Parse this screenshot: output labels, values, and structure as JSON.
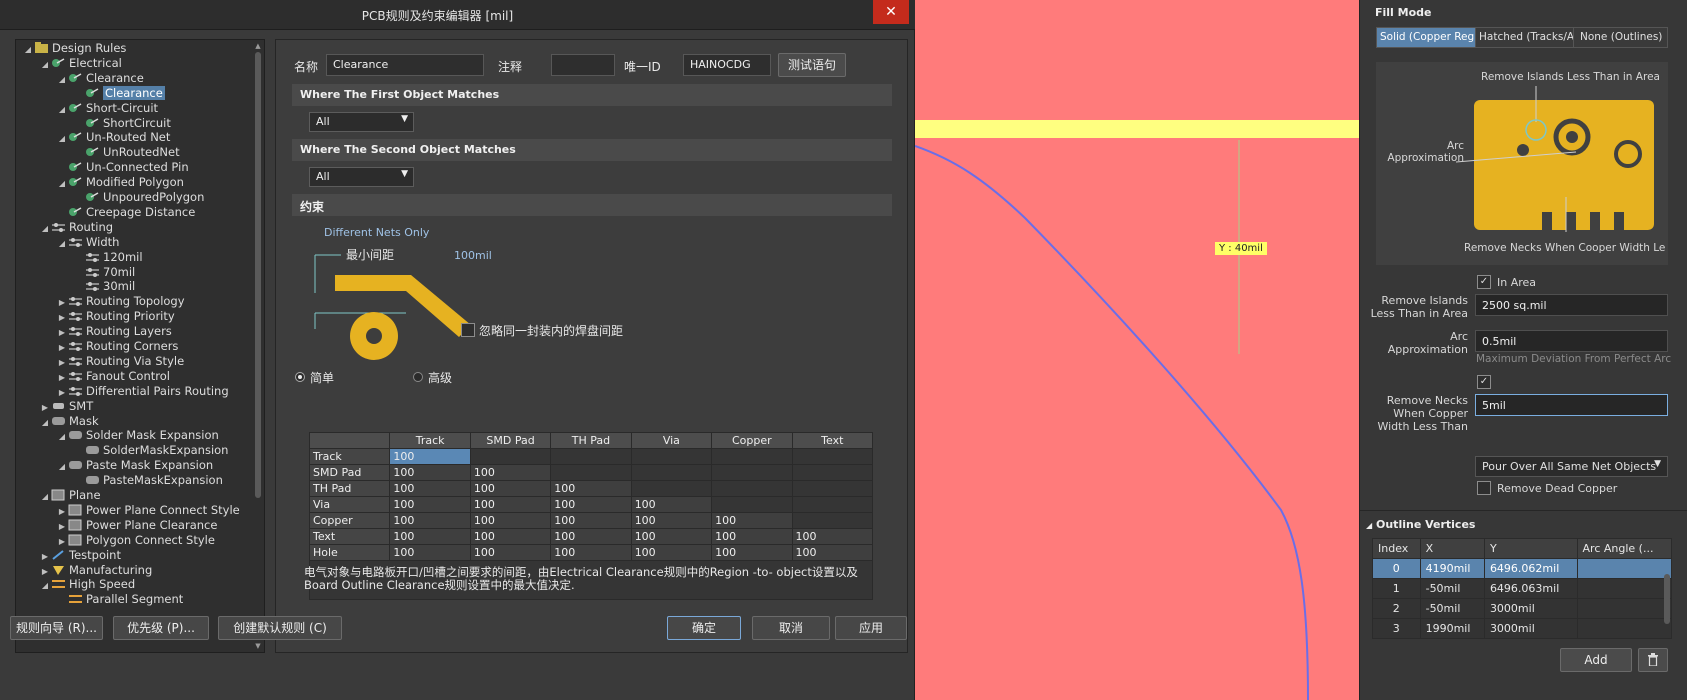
{
  "dialog": {
    "title": "PCB规则及约束编辑器 [mil]",
    "close_glyph": "✕"
  },
  "tree": {
    "root": "Design Rules",
    "electrical": "Electrical",
    "clearance_cat": "Clearance",
    "clearance_rule": "Clearance",
    "short_circuit_cat": "Short-Circuit",
    "short_circuit_rule": "ShortCircuit",
    "unrouted_cat": "Un-Routed Net",
    "unrouted_rule": "UnRoutedNet",
    "unconnected_pin": "Un-Connected Pin",
    "modified_polygon": "Modified Polygon",
    "unpoured_polygon": "UnpouredPolygon",
    "creepage": "Creepage Distance",
    "routing": "Routing",
    "width": "Width",
    "w120": "120mil",
    "w70": "70mil",
    "w30": "30mil",
    "routing_topology": "Routing Topology",
    "routing_priority": "Routing Priority",
    "routing_layers": "Routing Layers",
    "routing_corners": "Routing Corners",
    "routing_via_style": "Routing Via Style",
    "fanout_control": "Fanout Control",
    "diff_pairs": "Differential Pairs Routing",
    "smt": "SMT",
    "mask": "Mask",
    "solder_mask_cat": "Solder Mask Expansion",
    "solder_mask_rule": "SolderMaskExpansion",
    "paste_mask_cat": "Paste Mask Expansion",
    "paste_mask_rule": "PasteMaskExpansion",
    "plane": "Plane",
    "power_plane_connect": "Power Plane Connect Style",
    "power_plane_clearance": "Power Plane Clearance",
    "polygon_connect": "Polygon Connect Style",
    "testpoint": "Testpoint",
    "manufacturing": "Manufacturing",
    "high_speed": "High Speed",
    "parallel_segment": "Parallel Segment"
  },
  "form": {
    "name_label": "名称",
    "name_value": "Clearance",
    "comment_label": "注释",
    "comment_value": "",
    "uid_label": "唯一ID",
    "uid_value": "HAINOCDG",
    "test_button": "测试语句",
    "first_match": "Where The First Object Matches",
    "first_match_value": "All",
    "second_match": "Where The Second Object Matches",
    "second_match_value": "All",
    "constraints": "约束",
    "different_nets": "Different Nets Only",
    "min_clearance_label": "最小间距",
    "min_clearance_value": "100mil",
    "ignore_pads": "忽略同一封装内的焊盘间距",
    "mode_simple": "简单",
    "mode_advanced": "高级",
    "columns": [
      "",
      "Track",
      "SMD Pad",
      "TH Pad",
      "Via",
      "Copper",
      "Text"
    ],
    "rows": [
      {
        "label": "Track",
        "cells": [
          "100"
        ]
      },
      {
        "label": "SMD Pad",
        "cells": [
          "100",
          "100"
        ]
      },
      {
        "label": "TH Pad",
        "cells": [
          "100",
          "100",
          "100"
        ]
      },
      {
        "label": "Via",
        "cells": [
          "100",
          "100",
          "100",
          "100"
        ]
      },
      {
        "label": "Copper",
        "cells": [
          "100",
          "100",
          "100",
          "100",
          "100"
        ]
      },
      {
        "label": "Text",
        "cells": [
          "100",
          "100",
          "100",
          "100",
          "100",
          "100"
        ]
      },
      {
        "label": "Hole",
        "cells": [
          "100",
          "100",
          "100",
          "100",
          "100",
          "100"
        ]
      }
    ],
    "description": "电气对象与电路板开口/凹槽之间要求的间距，由Electrical Clearance规则中的Region -to- object设置以及Board Outline Clearance规则设置中的最大值决定."
  },
  "footer": {
    "wizard": "规则向导 (R)...",
    "priority": "优先级 (P)...",
    "create_default": "创建默认规则 (C)",
    "ok": "确定",
    "cancel": "取消",
    "apply": "应用"
  },
  "canvas": {
    "y_readout": "Y : 40mil",
    "background": "#ff7b7b",
    "track_color": "#ffff80"
  },
  "panel": {
    "fill_mode": "Fill Mode",
    "mode_solid": "Solid (Copper Regi",
    "mode_hatched": "Hatched (Tracks/Ar",
    "mode_none": "None (Outlines)",
    "diagram_islands": "Remove Islands Less Than in Area",
    "diagram_arc": "Arc Approximation",
    "diagram_necks": "Remove Necks When Cooper Width Le",
    "in_area": "In Area",
    "islands_label": "Remove Islands Less Than in Area",
    "islands_value": "2500 sq.mil",
    "arc_label": "Arc Approximation",
    "arc_value": "0.5mil",
    "arc_hint": "Maximum Deviation From Perfect Arc",
    "necks_label": "Remove Necks When Copper Width Less Than",
    "necks_value": "5mil",
    "pour_over": "Pour Over All Same Net Objects",
    "remove_dead": "Remove Dead Copper",
    "outline_vertices": "Outline Vertices",
    "ov_columns": [
      "Index",
      "X",
      "Y",
      "Arc Angle (..."
    ],
    "ov_rows": [
      [
        "0",
        "4190mil",
        "6496.062mil",
        ""
      ],
      [
        "1",
        "-50mil",
        "6496.063mil",
        ""
      ],
      [
        "2",
        "-50mil",
        "3000mil",
        ""
      ],
      [
        "3",
        "1990mil",
        "3000mil",
        ""
      ]
    ],
    "add_button": "Add",
    "accent": "#5a84ad"
  }
}
